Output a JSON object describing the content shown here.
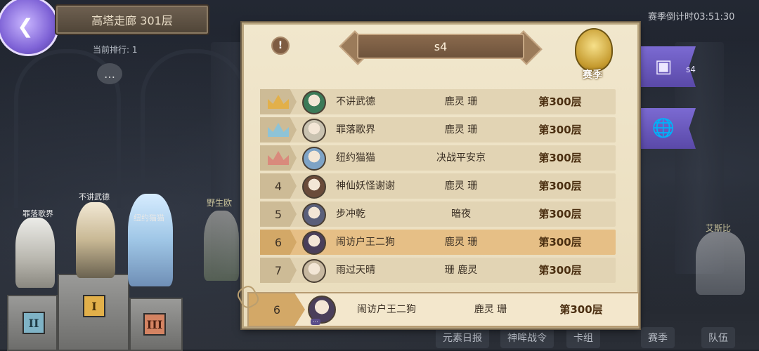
{
  "header": {
    "title": "高塔走廊 301层",
    "current_rank": "当前排行: 1",
    "season_timer": "赛季倒计时03:51:30"
  },
  "panel": {
    "season_name": "s4",
    "crest_label": "赛季",
    "info_glyph": "!",
    "rows": [
      {
        "rank": "",
        "crown": "gold",
        "name": "不讲武德",
        "guild": "鹿灵  珊",
        "floor": "第300层",
        "avatar_color": "#3c7a58"
      },
      {
        "rank": "",
        "crown": "silver",
        "name": "罪落歌界",
        "guild": "鹿灵  珊",
        "floor": "第300层",
        "avatar_color": "#c9c2b0"
      },
      {
        "rank": "",
        "crown": "bronze",
        "name": "纽约猫猫",
        "guild": "决战平安京",
        "floor": "第300层",
        "avatar_color": "#7ea3c6"
      },
      {
        "rank": "4",
        "crown": "",
        "name": "神仙妖怪谢谢",
        "guild": "鹿灵  珊",
        "floor": "第300层",
        "avatar_color": "#6a4b3a"
      },
      {
        "rank": "5",
        "crown": "",
        "name": "步冲乾",
        "guild": "暗夜",
        "floor": "第300层",
        "avatar_color": "#5a5f7a"
      },
      {
        "rank": "6",
        "crown": "",
        "name": "闹访户王二狗",
        "guild": "鹿灵  珊",
        "floor": "第300层",
        "avatar_color": "#4a3f5a",
        "highlight": true
      },
      {
        "rank": "7",
        "crown": "",
        "name": "雨过天晴",
        "guild": "珊  鹿灵",
        "floor": "第300层",
        "avatar_color": "#c7b8a0"
      }
    ],
    "my_row": {
      "rank": "6",
      "name": "闹访户王二狗",
      "guild": "鹿灵  珊",
      "floor": "第300层",
      "avatar_color": "#4a3f5a"
    }
  },
  "scene": {
    "podium_names": [
      "罪落歌界",
      "不讲武德",
      "纽约猫猫"
    ],
    "podium_badges": [
      "II",
      "I",
      "III"
    ],
    "bg_labels": [
      "野生欧",
      "艾斯比"
    ],
    "bottom_tabs": [
      "元素日报",
      "神哞战令",
      "卡组",
      "赛季",
      "队伍"
    ],
    "side_badge": "s4"
  },
  "colors": {
    "gold": "#e2b04a",
    "silver": "#8ec3d6",
    "bronze": "#d98a7c"
  }
}
